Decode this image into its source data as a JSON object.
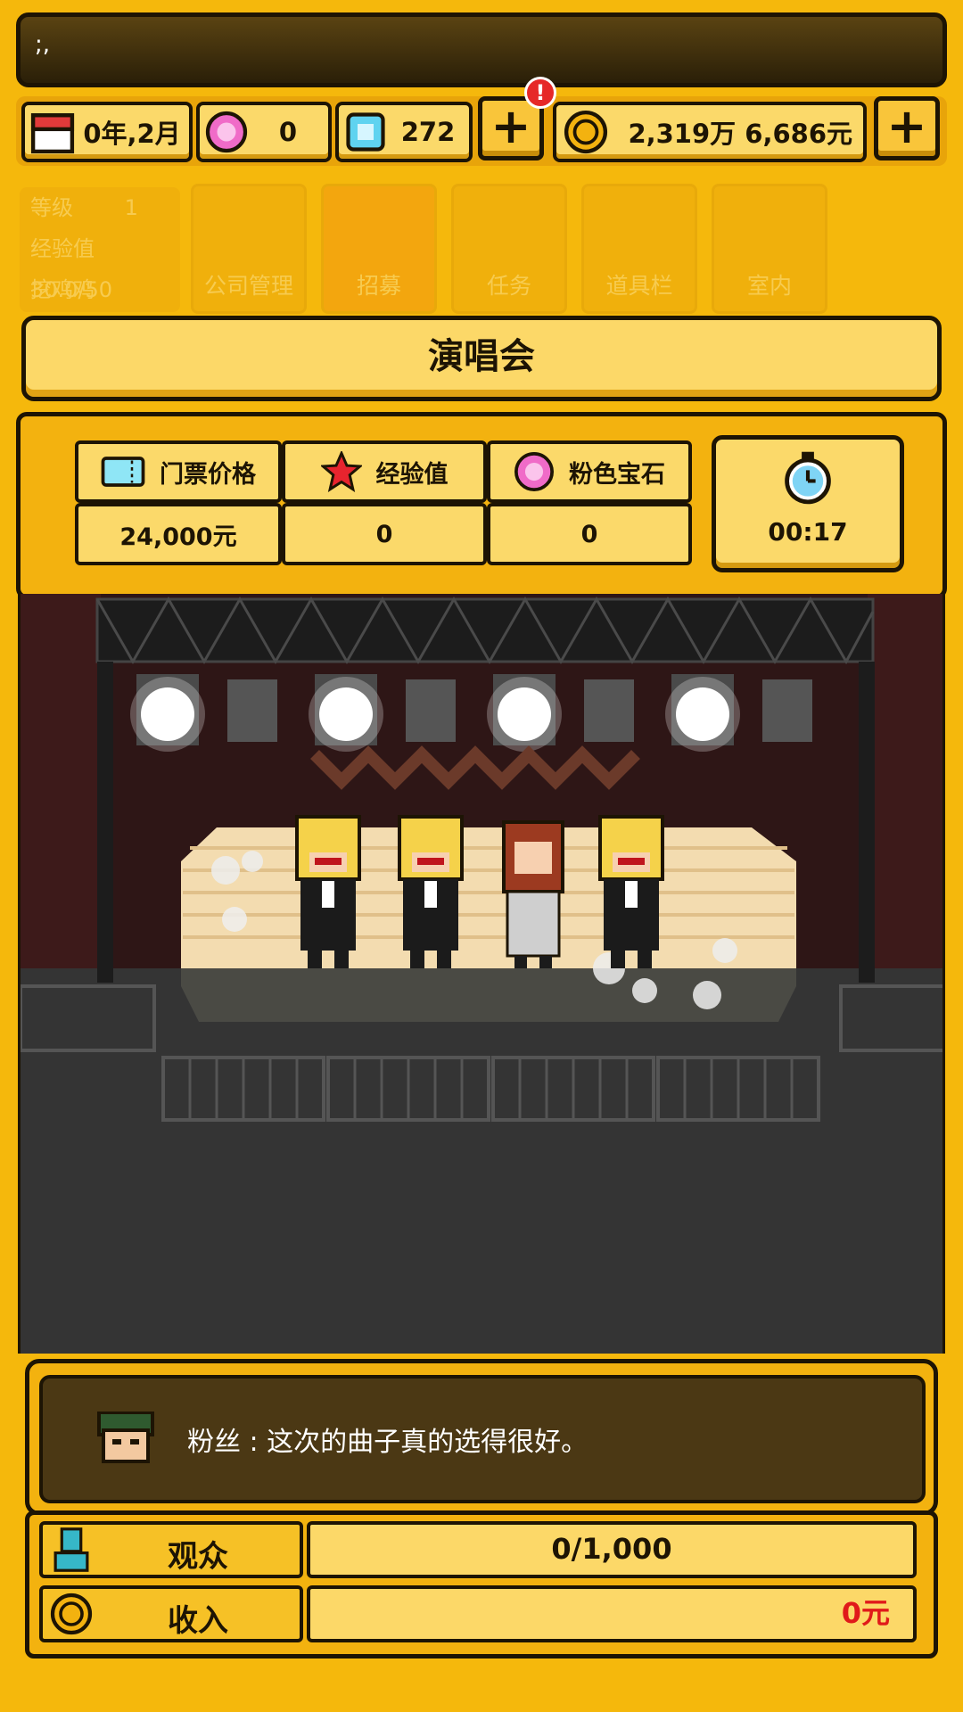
{
  "notice": {
    "text": ";,"
  },
  "resources": {
    "date": "0年,2月",
    "pink_gems": "0",
    "diamonds": "272",
    "money": "2,319万 6,686元",
    "alert_mark": "!"
  },
  "background_menu": {
    "level_label": "等级",
    "level_value": "1",
    "exp_text": "经验值 30.0/50",
    "player_name": "挖鸡鸡",
    "tiles": [
      "公司管理",
      "招募",
      "任务",
      "道具栏",
      "室内"
    ]
  },
  "popup": {
    "title": "演唱会",
    "stats": [
      {
        "label": "门票价格",
        "value": "24,000元",
        "icon": "ticket-icon"
      },
      {
        "label": "经验值",
        "value": "0",
        "icon": "star-icon"
      },
      {
        "label": "粉色宝石",
        "value": "0",
        "icon": "pink-gem-icon"
      }
    ],
    "timer": "00:17",
    "chat": {
      "speaker_icon": "fan-avatar-icon",
      "message": "粉丝 : 这次的曲子真的选得很好。"
    },
    "audience": {
      "label": "观众",
      "value": "0/1,000"
    },
    "income": {
      "label": "收入",
      "value": "0元"
    }
  },
  "colors": {
    "background": "#f5b80c",
    "panel_light": "#fbd96a",
    "outline": "#1d1404",
    "income_red": "#e01a1a",
    "stage_dark": "#353535"
  }
}
